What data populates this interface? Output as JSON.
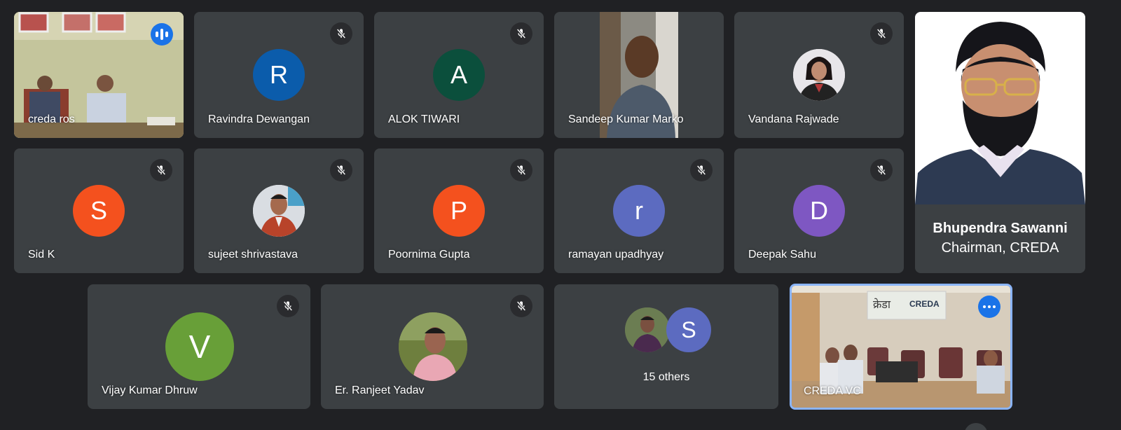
{
  "colors": {
    "background": "#202124",
    "tile": "#3c4043",
    "active_border": "#8ab4f8",
    "speaking_indicator": "#1a73e8"
  },
  "participants": [
    {
      "name": "creda ros",
      "video": true,
      "speaking": true
    },
    {
      "name": "Ravindra Dewangan",
      "initial": "R",
      "avatar_color": "#0b5cab",
      "muted": true
    },
    {
      "name": "ALOK TIWARI",
      "initial": "A",
      "avatar_color": "#0b4f3c",
      "muted": true
    },
    {
      "name": "Sandeep Kumar Marko",
      "video": true
    },
    {
      "name": "Vandana Rajwade",
      "photo": true,
      "muted": true
    },
    {
      "name": "Sid K",
      "initial": "S",
      "avatar_color": "#f4511e",
      "muted": true
    },
    {
      "name": "sujeet shrivastava",
      "photo": true,
      "muted": true
    },
    {
      "name": "Poornima Gupta",
      "initial": "P",
      "avatar_color": "#f4511e",
      "muted": true
    },
    {
      "name": "ramayan upadhyay",
      "initial": "r",
      "avatar_color": "#5c6bc0",
      "muted": true
    },
    {
      "name": "Deepak Sahu",
      "initial": "D",
      "avatar_color": "#7e57c2",
      "muted": true
    },
    {
      "name": "Vijay Kumar Dhruw",
      "initial": "V",
      "avatar_color": "#689f38",
      "muted": true
    },
    {
      "name": "Er. Ranjeet Yadav",
      "photo": true,
      "muted": true
    },
    {
      "name": "CREDA VC",
      "video": true,
      "pinned": true
    }
  ],
  "others": {
    "label": "15 others",
    "initial": "S",
    "avatar_color": "#5c6bc0"
  },
  "chairman": {
    "name": "Bhupendra Sawanni",
    "title": "Chairman, CREDA"
  },
  "room_sign": {
    "hindi": "क्रेडा",
    "english": "CREDA"
  },
  "icons": {
    "mic_off": "mic-off-icon",
    "speaking": "audio-level-icon",
    "more": "more-options-icon"
  }
}
